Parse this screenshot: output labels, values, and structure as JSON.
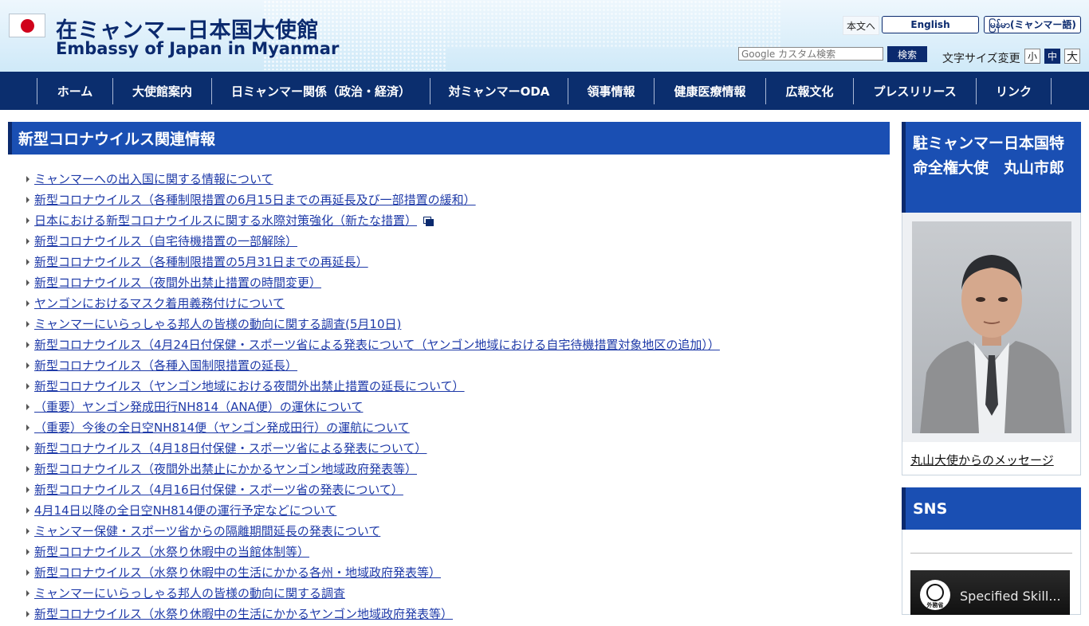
{
  "header": {
    "title_ja": "在ミャンマー日本国大使館",
    "title_en": "Embassy of Japan in Myanmar",
    "skip_link": "本文へ",
    "lang_english": "English",
    "lang_myanmar": "မြန်မာ(ミャンマー語)",
    "search_placeholder": "Google カスタム検索",
    "search_button": "検索",
    "font_size_label": "文字サイズ変更",
    "font_small": "小",
    "font_medium": "中",
    "font_large": "大"
  },
  "nav": [
    "ホーム",
    "大使館案内",
    "日ミャンマー関係（政治・経済）",
    "対ミャンマーODA",
    "領事情報",
    "健康医療情報",
    "広報文化",
    "プレスリリース",
    "リンク"
  ],
  "main": {
    "heading": "新型コロナウイルス関連情報",
    "links": [
      "ミャンマーへの出入国に関する情報について",
      "新型コロナウイルス（各種制限措置の6月15日までの再延長及び一部措置の緩和）",
      "日本における新型コロナウイルスに関する水際対策強化（新たな措置）",
      "新型コロナウイルス（自宅待機措置の一部解除）",
      "新型コロナウイルス（各種制限措置の5月31日までの再延長）",
      "新型コロナウイルス（夜間外出禁止措置の時間変更）",
      "ヤンゴンにおけるマスク着用義務付けについて",
      "ミャンマーにいらっしゃる邦人の皆様の動向に関する調査(5月10日)",
      "新型コロナウイルス（4月24日付保健・スポーツ省による発表について（ヤンゴン地域における自宅待機措置対象地区の追加））",
      "新型コロナウイルス（各種入国制限措置の延長）",
      "新型コロナウイルス（ヤンゴン地域における夜間外出禁止措置の延長について）",
      "（重要）ヤンゴン発成田行NH814（ANA便）の運休について",
      "（重要）今後の全日空NH814便（ヤンゴン発成田行）の運航について",
      "新型コロナウイルス（4月18日付保健・スポーツ省による発表について）",
      "新型コロナウイルス（夜間外出禁止にかかるヤンゴン地域政府発表等）",
      "新型コロナウイルス（4月16日付保健・スポーツ省の発表について）",
      "4月14日以降の全日空NH814便の運行予定などについて",
      "ミャンマー保健・スポーツ省からの隔離期間延長の発表について",
      "新型コロナウイルス（水祭り休暇中の当館体制等）",
      "新型コロナウイルス（水祭り休暇中の生活にかかる各州・地域政府発表等）",
      "ミャンマーにいらっしゃる邦人の皆様の動向に関する調査",
      "新型コロナウイルス（水祭り休暇中の生活にかかるヤンゴン地域政府発表等）"
    ]
  },
  "sidebar": {
    "ambassador_heading": "駐ミャンマー日本国特命全権大使　丸山市郎",
    "ambassador_link": "丸山大使からのメッセージ",
    "sns_heading": "SNS",
    "video_title": "Specified Skill...",
    "video_logo_text": "外務省"
  }
}
